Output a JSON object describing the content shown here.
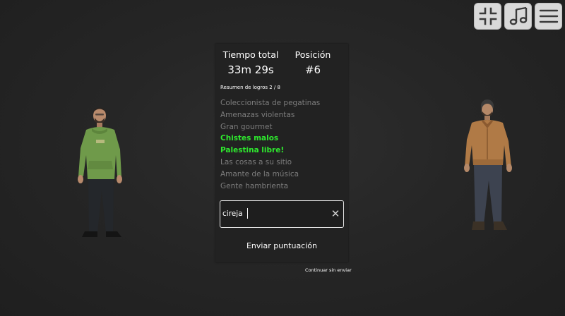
{
  "stats": {
    "time_label": "Tiempo total",
    "time_value": "33m 29s",
    "position_label": "Posición",
    "position_value": "#6"
  },
  "achievements_summary": "Resumen de logros 2 / 8",
  "achievements": [
    {
      "label": "Coleccionista de pegatinas",
      "unlocked": false
    },
    {
      "label": "Amenazas violentas",
      "unlocked": false
    },
    {
      "label": "Gran gourmet",
      "unlocked": false
    },
    {
      "label": "Chistes malos",
      "unlocked": true
    },
    {
      "label": "Palestina libre!",
      "unlocked": true
    },
    {
      "label": "Las cosas a su sitio",
      "unlocked": false
    },
    {
      "label": "Amante de la música",
      "unlocked": false
    },
    {
      "label": "Gente hambrienta",
      "unlocked": false
    }
  ],
  "name_input": {
    "value": "cireja"
  },
  "submit_label": "Enviar puntuación",
  "continue_label": "Continuar sin enviar",
  "top_buttons": {
    "fullscreen_icon": "fullscreen-exit-icon",
    "music_icon": "music-note-icon",
    "menu_icon": "hamburger-menu-icon"
  },
  "colors": {
    "unlocked": "#2ee82e",
    "locked": "#7c7c7c",
    "panel": "#222222"
  }
}
